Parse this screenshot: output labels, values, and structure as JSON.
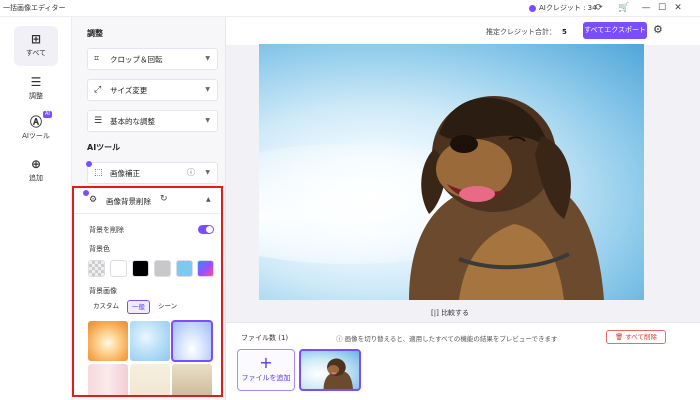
{
  "app": {
    "title": "一括画像エディター",
    "credit_label": "AIクレジット : 34"
  },
  "nav": [
    {
      "icon": "grid-icon",
      "label": "すべて"
    },
    {
      "icon": "sliders-icon",
      "label": "調整"
    },
    {
      "icon": "ai-icon",
      "label": "AIツール",
      "badge": "AI"
    },
    {
      "icon": "add-icon",
      "label": "追加"
    }
  ],
  "panel": {
    "adjust_title": "調整",
    "crop": "クロップ＆回転",
    "resize": "サイズ変更",
    "basic": "基本的な調整",
    "ai_title": "AIツール",
    "enhance": "画像補正",
    "bg_remove": {
      "title": "画像背景削除",
      "remove_label": "背景を削除",
      "remove_on": true,
      "color_label": "背景色",
      "colors": [
        "transparent",
        "#ffffff",
        "#000000",
        "#c8c8c8",
        "#7dcaf0",
        "gradient"
      ],
      "image_label": "背景画像",
      "tabs": [
        "カスタム",
        "一般",
        "シーン"
      ],
      "active_tab": "一般"
    }
  },
  "main": {
    "est_label": "推定クレジット合計：",
    "est_value": "5",
    "export_label": "すべてエクスポート",
    "compare_label": "比較する",
    "file_count": "ファイル数 (1)",
    "file_info": "画像を切り替えると、適用したすべての機能の結果をプレビューできます",
    "delete_all": "すべて削除",
    "add_file": "ファイルを追加"
  },
  "colors": {
    "accent": "#7a4dff",
    "highlight": "#e11c1c"
  }
}
